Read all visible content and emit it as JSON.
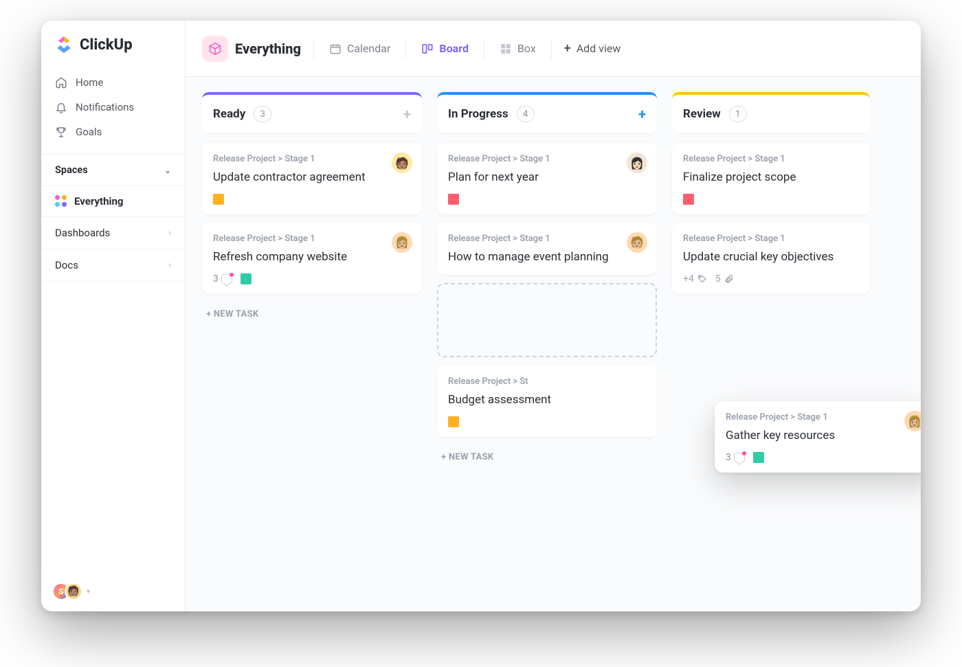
{
  "brand": {
    "name": "ClickUp"
  },
  "sidebar": {
    "nav": [
      {
        "icon": "home-icon",
        "label": "Home"
      },
      {
        "icon": "bell-icon",
        "label": "Notifications"
      },
      {
        "icon": "trophy-icon",
        "label": "Goals"
      }
    ],
    "spaces_header": "Spaces",
    "space_active": "Everything",
    "sections": [
      {
        "label": "Dashboards"
      },
      {
        "label": "Docs"
      }
    ],
    "user_initial": "S"
  },
  "topbar": {
    "title": "Everything",
    "views": [
      {
        "label": "Calendar",
        "icon": "calendar-icon",
        "active": false
      },
      {
        "label": "Board",
        "icon": "board-icon",
        "active": true
      },
      {
        "label": "Box",
        "icon": "box-icon",
        "active": false
      }
    ],
    "add_view_label": "Add view"
  },
  "board": {
    "breadcrumb": "Release Project > Stage 1",
    "new_task_label": "+ NEW TASK",
    "columns": [
      {
        "name": "Ready",
        "count": "3",
        "color": "#7b68ff",
        "cards": [
          {
            "title": "Update contractor agreement",
            "flag": "orange",
            "assignee": "yellow"
          },
          {
            "title": "Refresh company website",
            "comments": "3",
            "flag": "green",
            "assignee": "skin"
          }
        ]
      },
      {
        "name": "In Progress",
        "count": "4",
        "color": "#1e90ff",
        "cards": [
          {
            "title": "Plan for next year",
            "flag": "red",
            "assignee": "pale"
          },
          {
            "title": "How to manage event planning",
            "assignee": "skin"
          },
          {
            "title": "Budget assessment",
            "flag": "orange"
          }
        ]
      },
      {
        "name": "Review",
        "count": "1",
        "color": "#ffc400",
        "cards": [
          {
            "title": "Finalize project scope",
            "flag": "red"
          },
          {
            "title": "Update crucial key objectives",
            "tags": "+4",
            "attachments": "5"
          }
        ]
      }
    ],
    "dragging_card": {
      "title": "Gather key resources",
      "comments": "3",
      "flag": "green",
      "assignee": "skin"
    },
    "partial_breadcrumb": "Release Project > St"
  }
}
